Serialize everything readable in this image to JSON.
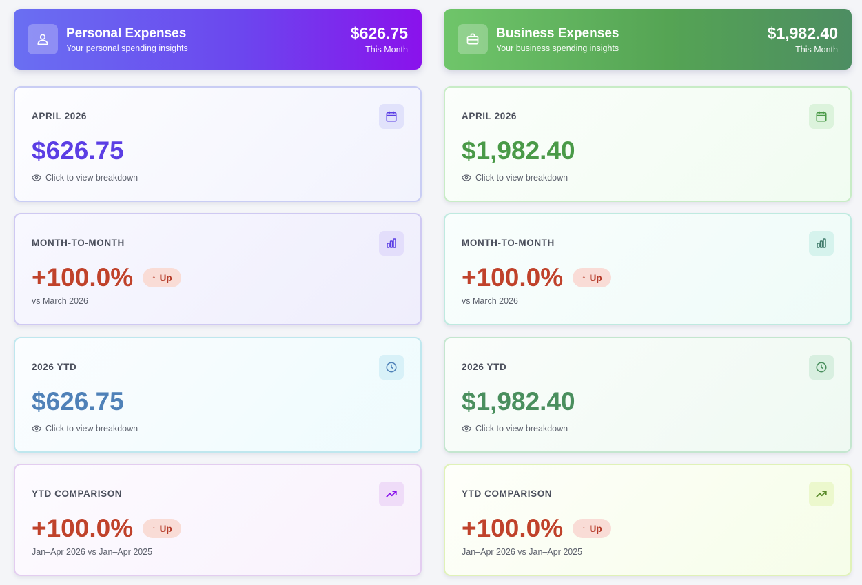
{
  "personal": {
    "header": {
      "title": "Personal Expenses",
      "subtitle": "Your personal spending insights",
      "amount": "$626.75",
      "period": "This Month",
      "icon": "user-icon"
    },
    "month_card": {
      "label": "APRIL 2026",
      "value": "$626.75",
      "footer": "Click to view breakdown",
      "icon": "calendar-icon"
    },
    "mtm_card": {
      "label": "MONTH-TO-MONTH",
      "value": "+100.0%",
      "badge": "Up",
      "footer": "vs March 2026",
      "icon": "bar-chart-icon"
    },
    "ytd_card": {
      "label": "2026 YTD",
      "value": "$626.75",
      "footer": "Click to view breakdown",
      "icon": "clock-icon"
    },
    "ytd_comparison_card": {
      "label": "YTD COMPARISON",
      "value": "+100.0%",
      "badge": "Up",
      "footer": "Jan–Apr 2026 vs Jan–Apr 2025",
      "icon": "trending-up-icon"
    }
  },
  "business": {
    "header": {
      "title": "Business Expenses",
      "subtitle": "Your business spending insights",
      "amount": "$1,982.40",
      "period": "This Month",
      "icon": "briefcase-icon"
    },
    "month_card": {
      "label": "APRIL 2026",
      "value": "$1,982.40",
      "footer": "Click to view breakdown",
      "icon": "calendar-icon"
    },
    "mtm_card": {
      "label": "MONTH-TO-MONTH",
      "value": "+100.0%",
      "badge": "Up",
      "footer": "vs March 2026",
      "icon": "bar-chart-icon"
    },
    "ytd_card": {
      "label": "2026 YTD",
      "value": "$1,982.40",
      "footer": "Click to view breakdown",
      "icon": "clock-icon"
    },
    "ytd_comparison_card": {
      "label": "YTD COMPARISON",
      "value": "+100.0%",
      "badge": "Up",
      "footer": "Jan–Apr 2026 vs Jan–Apr 2025",
      "icon": "trending-up-icon"
    }
  },
  "colors": {
    "personal_accent": "#5b3ee4",
    "business_accent": "#4a9a48",
    "up_change": "#c0422b",
    "up_badge_bg": "#f9dcd6"
  }
}
